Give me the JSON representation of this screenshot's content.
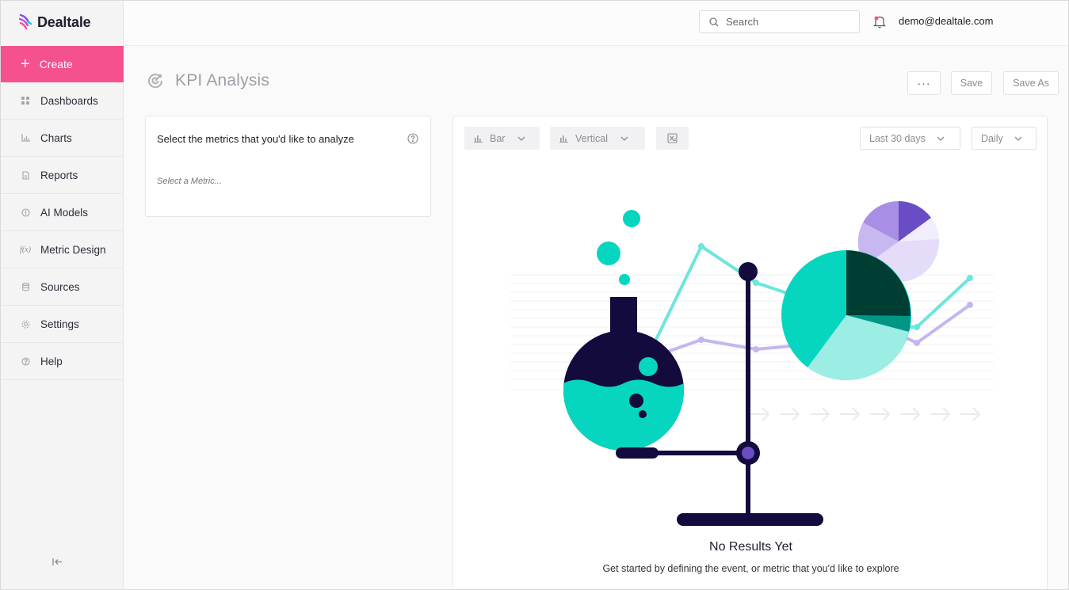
{
  "app": {
    "name": "Dealtale"
  },
  "sidebar": {
    "create_label": "Create",
    "items": [
      {
        "label": "Dashboards",
        "icon": "grid-icon"
      },
      {
        "label": "Charts",
        "icon": "bar-chart-icon"
      },
      {
        "label": "Reports",
        "icon": "document-icon"
      },
      {
        "label": "AI Models",
        "icon": "ai-icon"
      },
      {
        "label": "Metric Design",
        "icon": "function-icon"
      },
      {
        "label": "Sources",
        "icon": "database-icon"
      },
      {
        "label": "Settings",
        "icon": "gear-icon"
      },
      {
        "label": "Help",
        "icon": "help-icon"
      }
    ],
    "fx_icon_text": "f(x)"
  },
  "header": {
    "search_placeholder": "Search",
    "user_email": "demo@dealtale.com"
  },
  "page": {
    "title": "KPI Analysis",
    "more_label": "···",
    "save_label": "Save",
    "save_as_label": "Save As"
  },
  "metrics_panel": {
    "title": "Select the metrics that you'd like to analyze",
    "placeholder": "Select a Metric..."
  },
  "chart_toolbar": {
    "chart_type": "Bar",
    "orientation": "Vertical",
    "date_range": "Last 30 days",
    "granularity": "Daily"
  },
  "empty_state": {
    "title": "No Results Yet",
    "subtitle": "Get started by defining the event, or metric that you'd like to explore"
  },
  "colors": {
    "accent_pink": "#f5518f",
    "teal": "#06d6c0",
    "navy": "#130a3d",
    "purple": "#6a4cc4",
    "lavender": "#c8b8f0",
    "dark_green": "#003d33"
  }
}
